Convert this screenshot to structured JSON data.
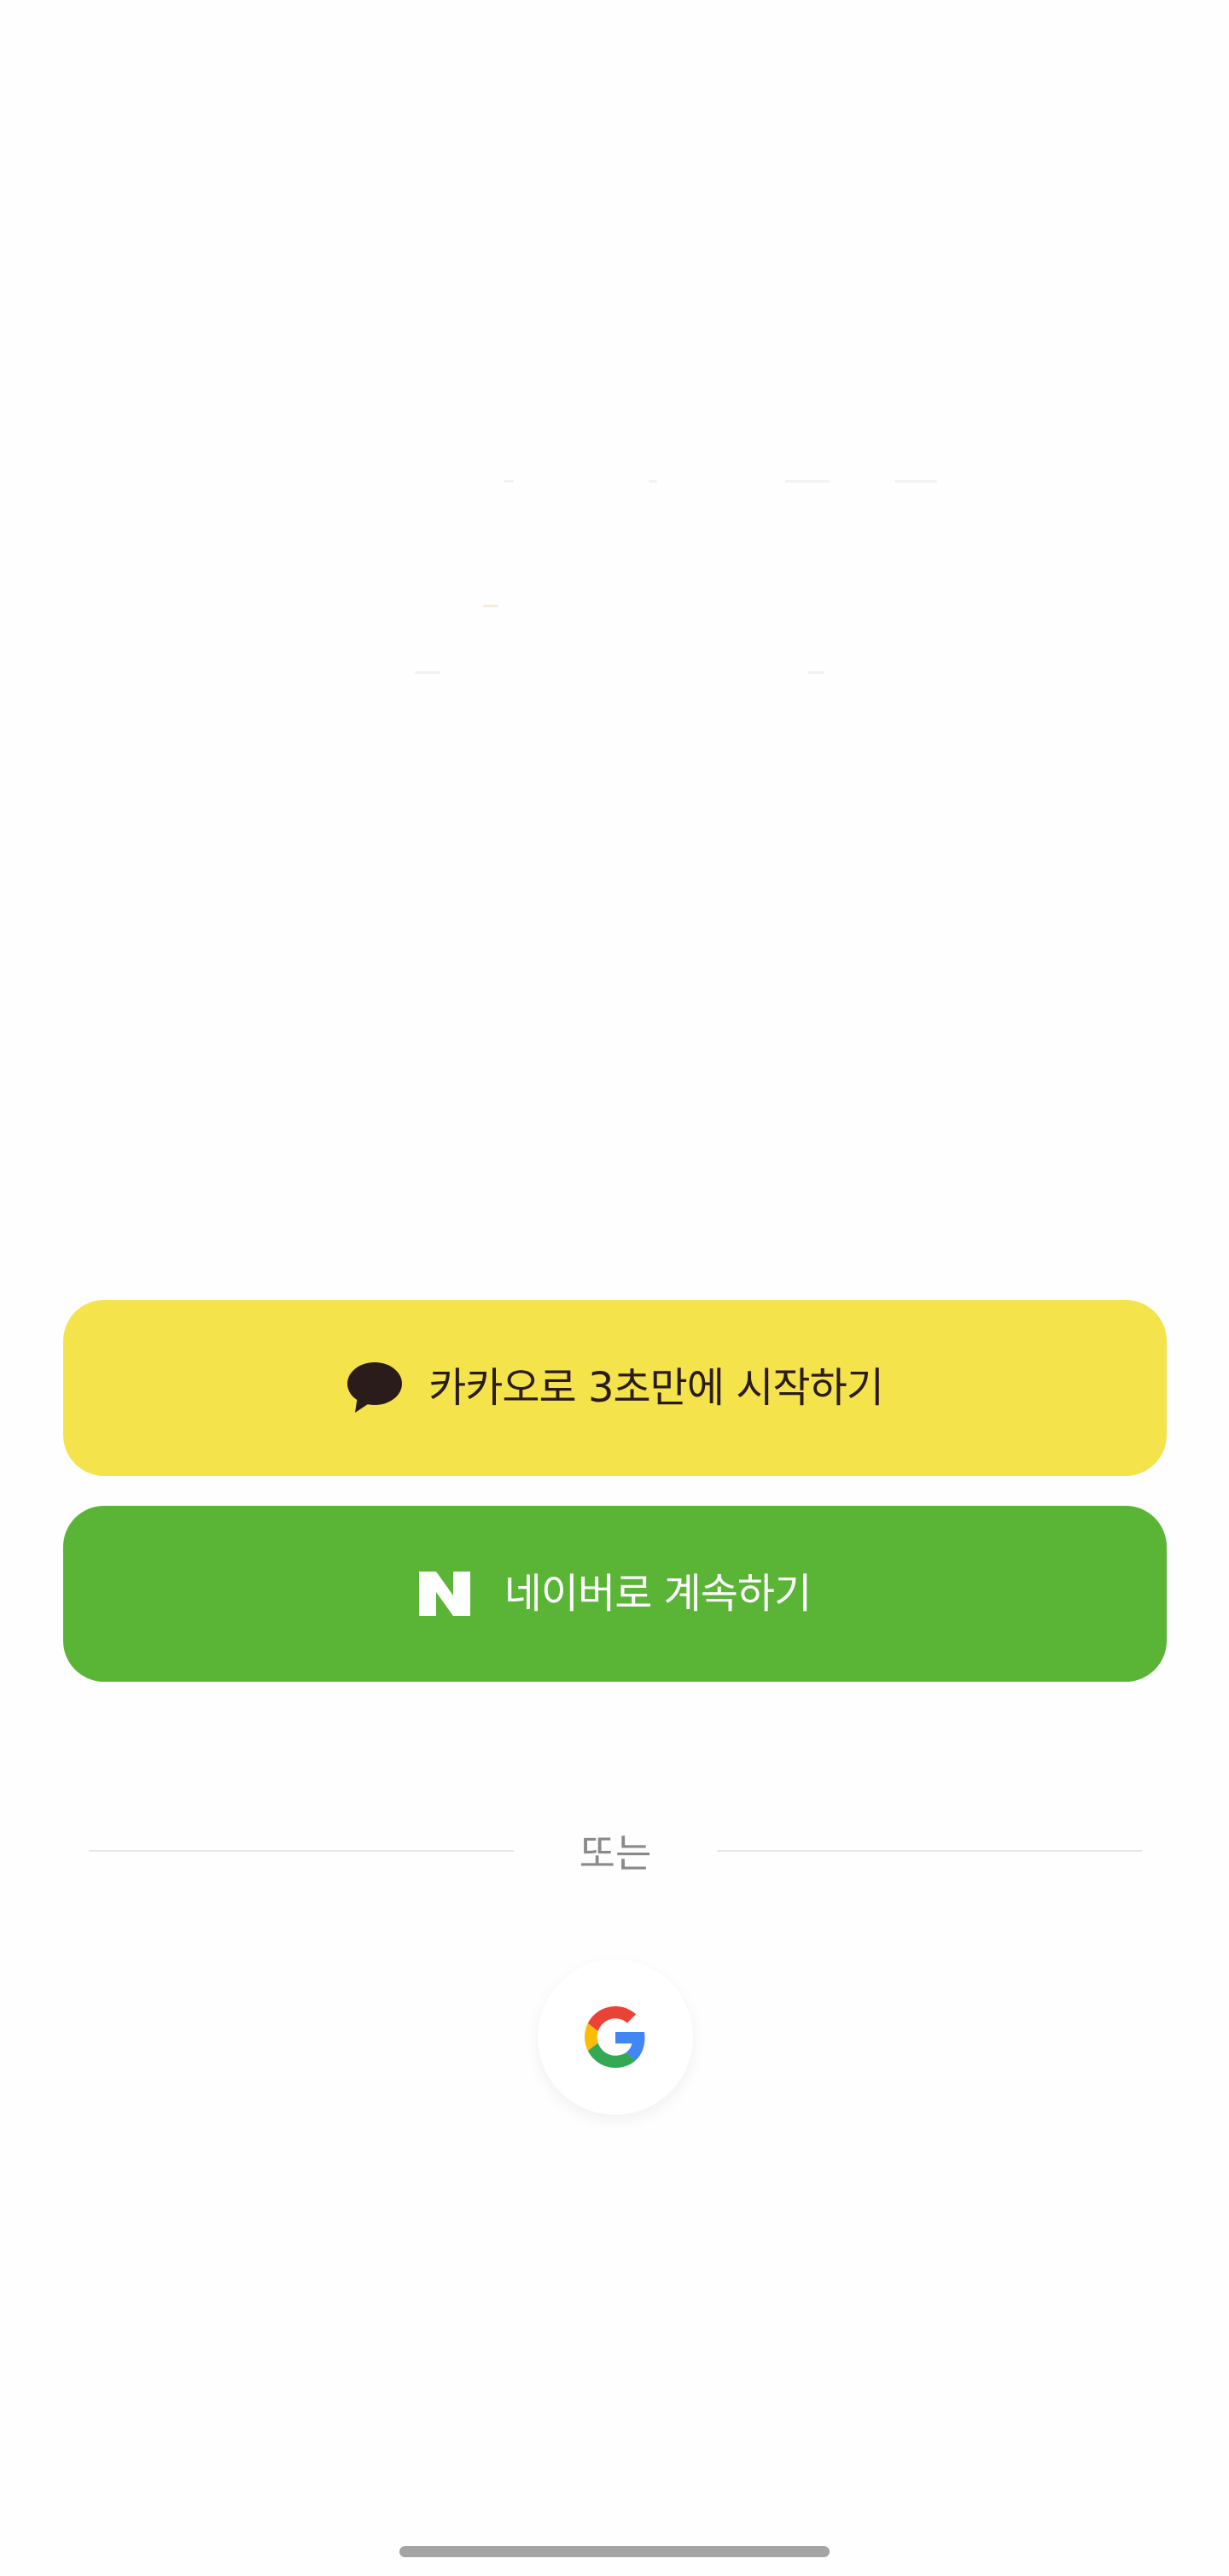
{
  "login": {
    "kakao_label": "카카오로 3초만에 시작하기",
    "naver_label": "네이버로 계속하기",
    "divider_text": "또는"
  },
  "icons": {
    "kakao": "speech-bubble-icon",
    "naver": "naver-n-icon",
    "google": "google-g-icon"
  },
  "colors": {
    "kakao_bg": "#f4e34b",
    "naver_bg": "#5ab436",
    "kakao_text": "#2a1c1a",
    "naver_text": "#ffffff"
  }
}
